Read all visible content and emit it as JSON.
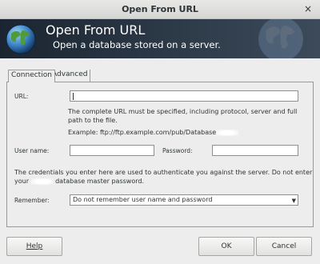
{
  "window": {
    "title": "Open From URL",
    "close_glyph": "×"
  },
  "banner": {
    "title": "Open From URL",
    "subtitle": "Open a database stored on a server.",
    "icon": "globe-icon"
  },
  "tabs": [
    {
      "label": "Connection"
    },
    {
      "label": "Advanced"
    }
  ],
  "form": {
    "url_label": "URL:",
    "url_value": "",
    "url_help_1": "The complete URL must be specified, including protocol, server and full",
    "url_help_2": "path to the file.",
    "example": "Example: ftp://ftp.example.com/pub/Database",
    "username_label": "User name:",
    "username_value": "",
    "password_label": "Password:",
    "password_value": "",
    "credentials_note_1": "The credentials you enter here are used to authenticate you against the server. Do not enter",
    "credentials_note_2a": "your",
    "credentials_note_2b": "database master password.",
    "remember_label": "Remember:",
    "remember_value": "Do not remember user name and password"
  },
  "buttons": {
    "help": "Help",
    "ok": "OK",
    "cancel": "Cancel"
  }
}
